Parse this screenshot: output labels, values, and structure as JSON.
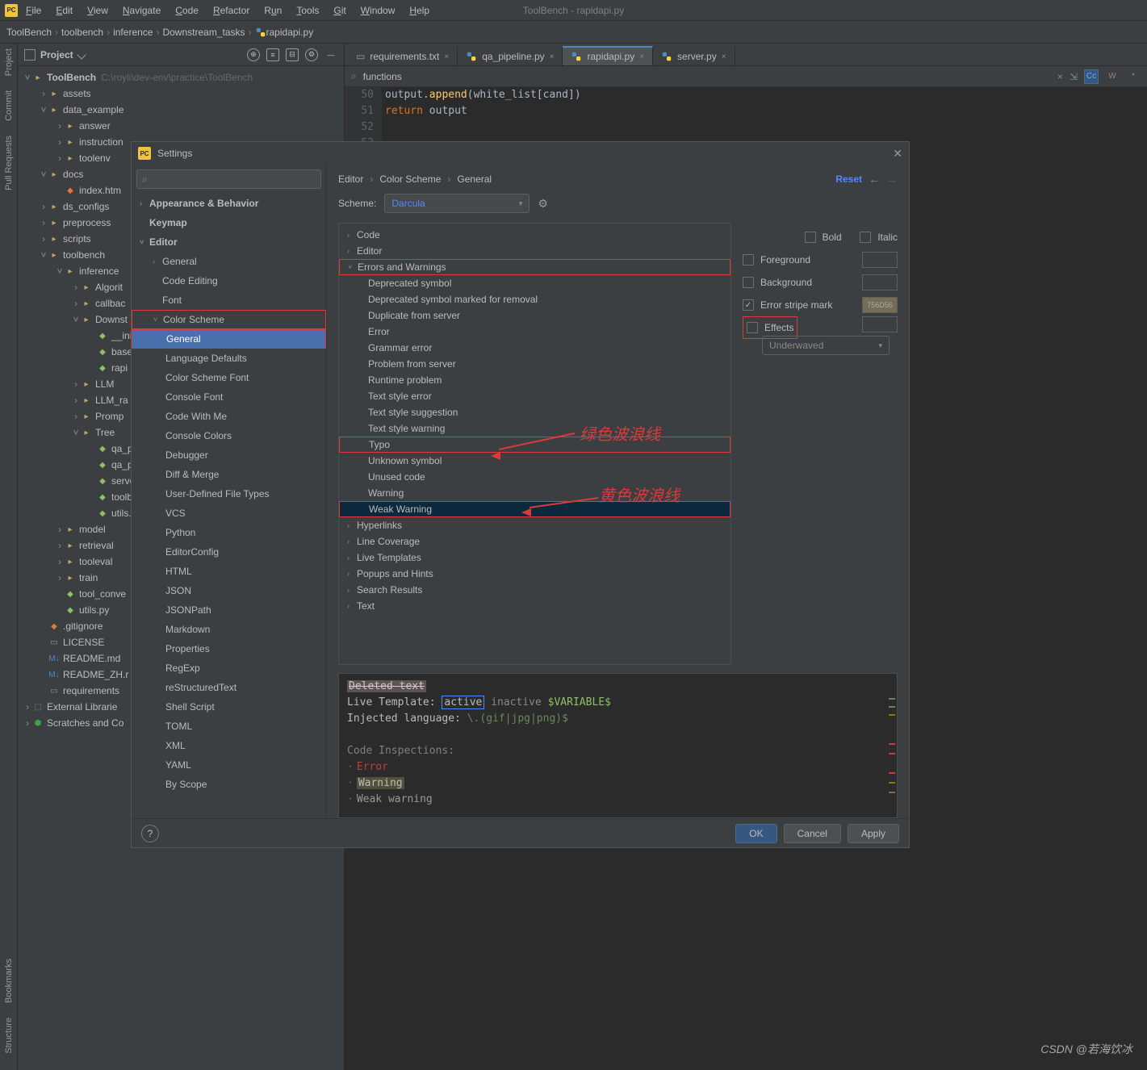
{
  "window_title": "ToolBench - rapidapi.py",
  "menus": [
    "File",
    "Edit",
    "View",
    "Navigate",
    "Code",
    "Refactor",
    "Run",
    "Tools",
    "Git",
    "Window",
    "Help"
  ],
  "breadcrumb": [
    "ToolBench",
    "toolbench",
    "inference",
    "Downstream_tasks",
    "rapidapi.py"
  ],
  "leftstrip": [
    "Project",
    "Commit",
    "Pull Requests",
    "Bookmarks",
    "Structure"
  ],
  "project": {
    "header": "Project",
    "root": "ToolBench",
    "rootpath": "C:\\royli\\dev-env\\practice\\ToolBench",
    "assets": "assets",
    "data_example": "data_example",
    "answer": "answer",
    "instruction": "instruction",
    "toolenv": "toolenv",
    "docs": "docs",
    "indexhtm": "index.htm",
    "ds_configs": "ds_configs",
    "preprocess": "preprocess",
    "scripts": "scripts",
    "toolbench": "toolbench",
    "inference": "inference",
    "algori": "Algorit",
    "callbac": "callbac",
    "downs": "Downst",
    "ini": "__ini",
    "base": "base",
    "rapi": "rapi",
    "llm": "LLM",
    "llm_ra": "LLM_ra",
    "promp": "Promp",
    "tree": "Tree",
    "qa_pipe1": "qa_pipe",
    "qa_pipe2": "qa_pipe",
    "serverp": "server.p",
    "toolben": "toolben",
    "utilspy": "utils.py",
    "model": "model",
    "retrieval": "retrieval",
    "tooleval": "tooleval",
    "train": "train",
    "tool_conv": "tool_conve",
    "utils2": "utils.py",
    "gitignore": ".gitignore",
    "license": "LICENSE",
    "readmemd": "README.md",
    "readmezh": "README_ZH.r",
    "requirements": "requirements",
    "external": "External Librarie",
    "scratches": "Scratches and Co"
  },
  "editor": {
    "tabs": [
      {
        "name": "requirements.txt",
        "type": "txt"
      },
      {
        "name": "qa_pipeline.py",
        "type": "py"
      },
      {
        "name": "rapidapi.py",
        "type": "py",
        "active": true
      },
      {
        "name": "server.py",
        "type": "py"
      }
    ],
    "find_placeholder": "functions",
    "find_icons": [
      "Cc",
      "W",
      "*"
    ],
    "lines": [
      {
        "n": "50",
        "txt": "        output.append(white_list[cand])"
      },
      {
        "n": "51",
        "txt": "    return output",
        "kw": "return",
        "rest": " output"
      },
      {
        "n": "52",
        "txt": ""
      },
      {
        "n": "53",
        "txt": ""
      }
    ]
  },
  "settings": {
    "title": "Settings",
    "search": "",
    "nav": {
      "appearance": "Appearance & Behavior",
      "keymap": "Keymap",
      "editor": "Editor",
      "general": "General",
      "code_editing": "Code Editing",
      "font": "Font",
      "color_scheme": "Color Scheme",
      "cs_general": "General",
      "lang_defaults": "Language Defaults",
      "cs_font": "Color Scheme Font",
      "console_font": "Console Font",
      "code_with_me": "Code With Me",
      "console_colors": "Console Colors",
      "debugger": "Debugger",
      "diff_merge": "Diff & Merge",
      "user_defined": "User-Defined File Types",
      "vcs": "VCS",
      "python": "Python",
      "editorconfig": "EditorConfig",
      "html": "HTML",
      "json": "JSON",
      "jsonpath": "JSONPath",
      "markdown": "Markdown",
      "properties": "Properties",
      "regexp": "RegExp",
      "rst": "reStructuredText",
      "shell": "Shell Script",
      "toml": "TOML",
      "xml": "XML",
      "yaml": "YAML",
      "byscope": "By Scope"
    },
    "bc": [
      "Editor",
      "Color Scheme",
      "General"
    ],
    "reset": "Reset",
    "scheme_label": "Scheme:",
    "scheme": "Darcula",
    "categories": {
      "code": "Code",
      "editor": "Editor",
      "errors": "Errors and Warnings",
      "dep_sym": "Deprecated symbol",
      "dep_rem": "Deprecated symbol marked for removal",
      "dup": "Duplicate from server",
      "error": "Error",
      "grammar": "Grammar error",
      "problem": "Problem from server",
      "runtime": "Runtime problem",
      "tse": "Text style error",
      "tss": "Text style suggestion",
      "tsw": "Text style warning",
      "typo": "Typo",
      "unknown": "Unknown symbol",
      "unused": "Unused code",
      "warning": "Warning",
      "weak": "Weak Warning",
      "hyperlinks": "Hyperlinks",
      "linecov": "Line Coverage",
      "livetmpl": "Live Templates",
      "popups": "Popups and Hints",
      "search": "Search Results",
      "text": "Text"
    },
    "props": {
      "bold": "Bold",
      "italic": "Italic",
      "foreground": "Foreground",
      "background": "Background",
      "stripe": "Error stripe mark",
      "stripe_val": "756D56",
      "effects": "Effects",
      "underwaved": "Underwaved"
    },
    "preview": {
      "deleted": "Deleted text",
      "lt": "Live Template:",
      "active": "active",
      "inactive": "inactive",
      "var": "$VARIABLE$",
      "inj": "Injected language:",
      "regex": "\\.(gif|jpg|png)$",
      "ci": "Code Inspections:",
      "err": "Error",
      "wrn": "Warning",
      "wkw": "Weak warning"
    },
    "buttons": {
      "ok": "OK",
      "cancel": "Cancel",
      "apply": "Apply"
    }
  },
  "annotations": {
    "green": "绿色波浪线",
    "yellow": "黄色波浪线"
  },
  "watermark": "CSDN @若海饮冰"
}
